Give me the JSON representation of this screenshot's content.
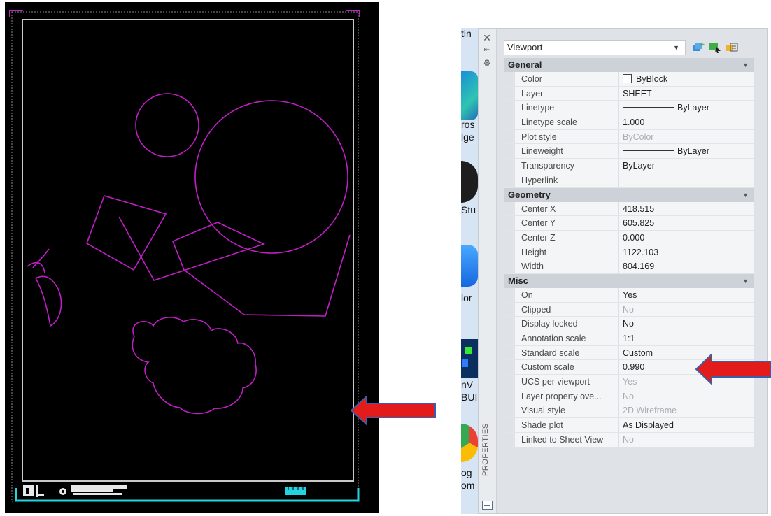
{
  "palette": {
    "title": "PROPERTIES",
    "object_type": "Viewport",
    "categories": [
      {
        "name": "General",
        "rows": [
          {
            "name": "Color",
            "value": "ByBlock",
            "style": "check"
          },
          {
            "name": "Layer",
            "value": "SHEET"
          },
          {
            "name": "Linetype",
            "value": "ByLayer",
            "style": "line"
          },
          {
            "name": "Linetype scale",
            "value": "1.000"
          },
          {
            "name": "Plot style",
            "value": "ByColor",
            "dim": true
          },
          {
            "name": "Lineweight",
            "value": "ByLayer",
            "style": "line"
          },
          {
            "name": "Transparency",
            "value": "ByLayer"
          },
          {
            "name": "Hyperlink",
            "value": ""
          }
        ]
      },
      {
        "name": "Geometry",
        "rows": [
          {
            "name": "Center X",
            "value": "418.515"
          },
          {
            "name": "Center Y",
            "value": "605.825"
          },
          {
            "name": "Center Z",
            "value": "0.000"
          },
          {
            "name": "Height",
            "value": "1122.103"
          },
          {
            "name": "Width",
            "value": "804.169"
          }
        ]
      },
      {
        "name": "Misc",
        "rows": [
          {
            "name": "On",
            "value": "Yes"
          },
          {
            "name": "Clipped",
            "value": "No",
            "dim": true
          },
          {
            "name": "Display locked",
            "value": "No"
          },
          {
            "name": "Annotation scale",
            "value": "1:1"
          },
          {
            "name": "Standard scale",
            "value": "Custom"
          },
          {
            "name": "Custom scale",
            "value": "0.990"
          },
          {
            "name": "UCS per viewport",
            "value": "Yes",
            "dim": true
          },
          {
            "name": "Layer property ove...",
            "value": "No",
            "dim": true
          },
          {
            "name": "Visual style",
            "value": "2D Wireframe",
            "dim": true
          },
          {
            "name": "Shade plot",
            "value": "As Displayed"
          },
          {
            "name": "Linked to Sheet View",
            "value": "No",
            "dim": true
          }
        ]
      }
    ]
  },
  "taskbar": {
    "fragments": [
      "tin",
      "ros",
      "lge",
      "Stu",
      "lor",
      "nV",
      "BUI",
      "og",
      "om"
    ]
  },
  "colors": {
    "drawing_bg": "#000000",
    "geometry": "#c21ec8",
    "viewport_border": "#c8c8c8",
    "title_block": "#23d3e0",
    "arrow_fill": "#e31b1b",
    "arrow_outline": "#3b5ea8"
  },
  "icons": [
    "close-icon",
    "auto-hide-icon",
    "settings-icon",
    "quick-select-icon",
    "select-objects-icon",
    "toggle-pickadd-icon",
    "collapse-arrow-icon",
    "dropdown-caret-icon"
  ]
}
